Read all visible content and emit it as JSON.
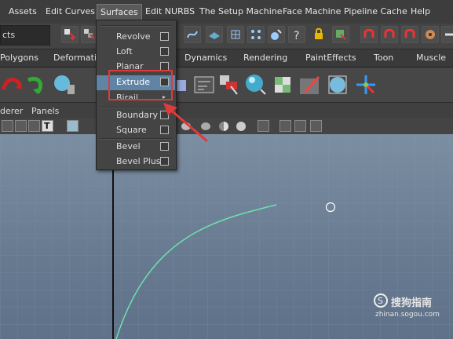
{
  "menubar": {
    "items": [
      "Assets",
      "Edit Curves",
      "Surfaces",
      "Edit NURBS",
      "The Setup Machine",
      "Face Machine",
      "Pipeline Cache",
      "Help"
    ],
    "active": "Surfaces"
  },
  "statusline": {
    "mode_field": "cts"
  },
  "shelf_tabs": [
    "Polygons",
    "Deformation",
    "Dynamics",
    "Rendering",
    "PaintEffects",
    "Toon",
    "Muscle"
  ],
  "panel_menu": {
    "renderer": "derer",
    "panels": "Panels"
  },
  "surfaces_menu": {
    "items": [
      {
        "label": "Revolve",
        "option_box": true
      },
      {
        "label": "Loft",
        "option_box": true
      },
      {
        "label": "Planar",
        "option_box": true
      },
      {
        "label": "Extrude",
        "option_box": true,
        "highlighted": true
      },
      {
        "label": "Birail",
        "submenu": true
      },
      {
        "label": "Boundary",
        "option_box": true
      },
      {
        "label": "Square",
        "option_box": true
      },
      {
        "label": "Bevel",
        "option_box": true
      },
      {
        "label": "Bevel Plus",
        "option_box": true
      }
    ]
  },
  "watermark": {
    "brand": "搜狗指南",
    "url": "zhinan.sogou.com"
  },
  "colors": {
    "menu_bg": "#3d3d3d",
    "highlight": "#5f84a6",
    "annotation_red": "#e03a3a",
    "curve": "#6fe0b0",
    "viewport_top": "#7c8ea2"
  }
}
